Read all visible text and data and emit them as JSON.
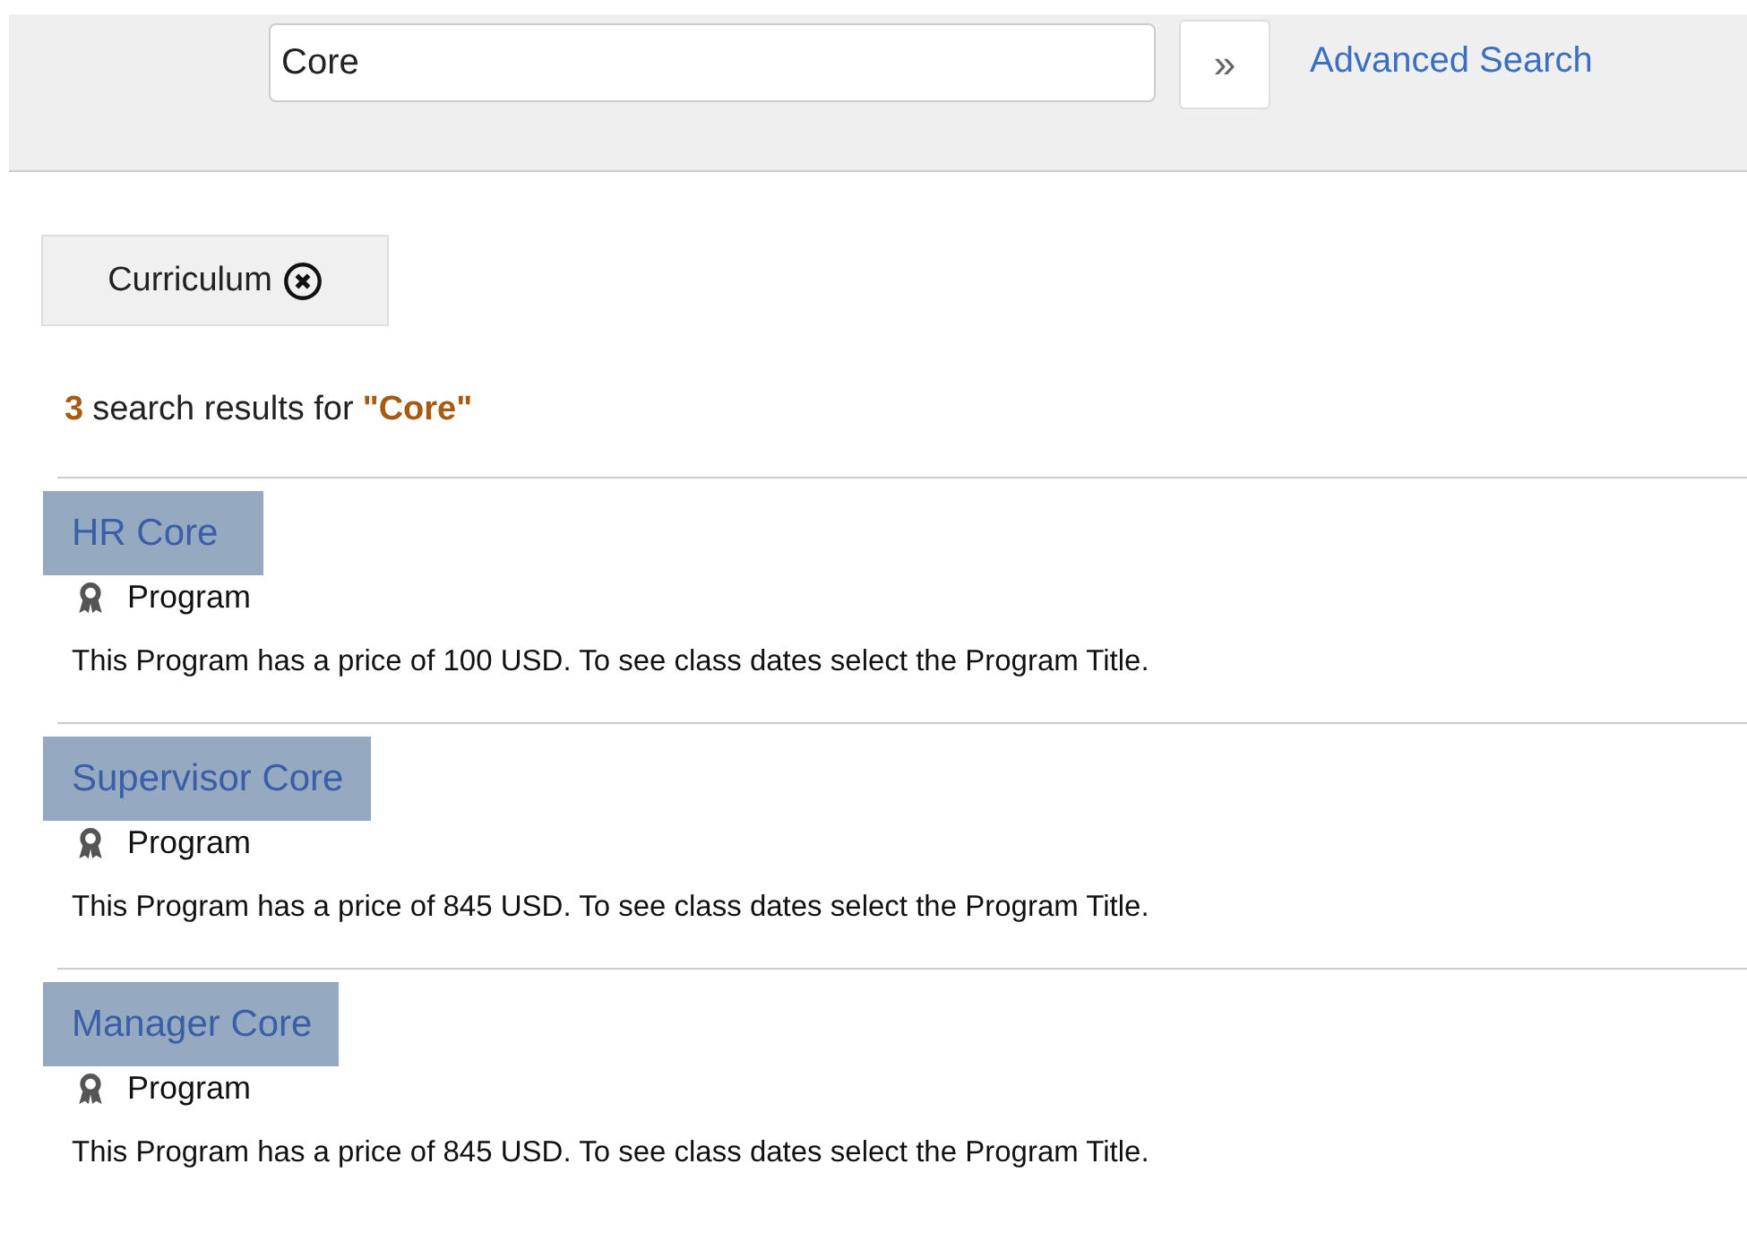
{
  "search": {
    "value": "Core",
    "submit_label": "»",
    "advanced_link": "Advanced Search"
  },
  "filters": [
    {
      "label": "Curriculum"
    }
  ],
  "results_summary": {
    "count": "3",
    "text": "search results for",
    "query": "\"Core\""
  },
  "results": [
    {
      "title": "HR Core",
      "type": "Program",
      "description": "This Program has a price of 100 USD. To see class dates select the Program Title."
    },
    {
      "title": "Supervisor Core",
      "type": "Program",
      "description": "This Program has a price of 845 USD. To see class dates select the Program Title."
    },
    {
      "title": "Manager Core",
      "type": "Program",
      "description": "This Program has a price of 845 USD. To see class dates select the Program Title."
    }
  ]
}
